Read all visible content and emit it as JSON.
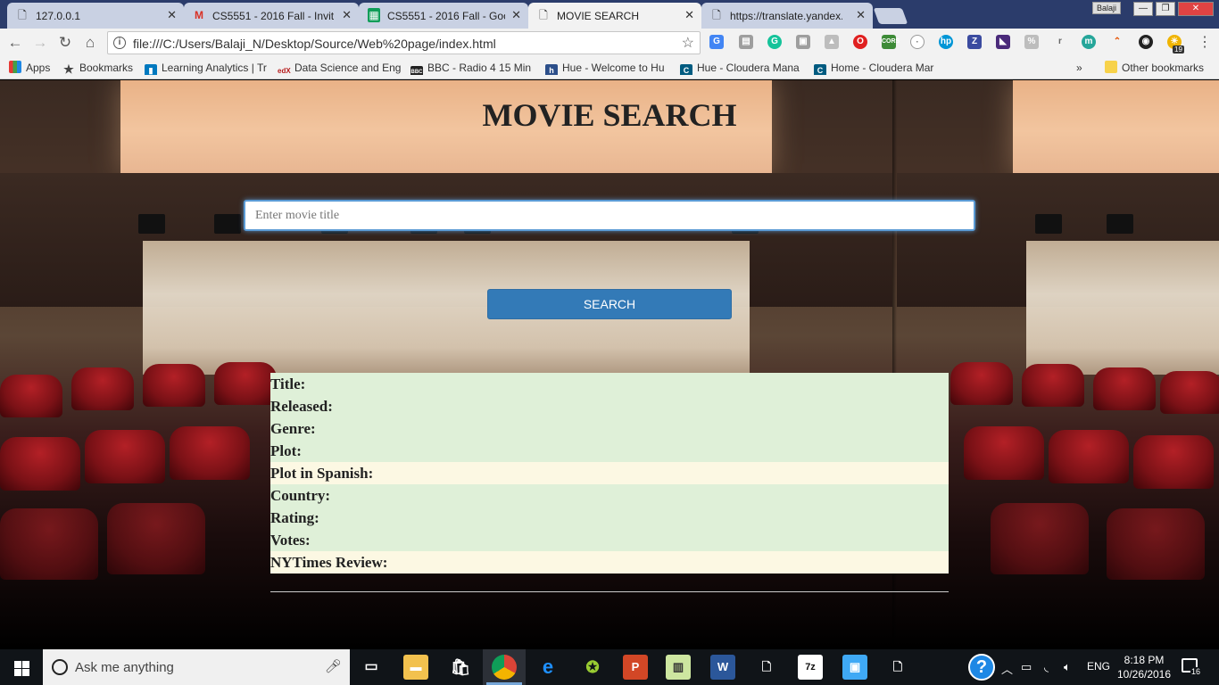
{
  "browser": {
    "tabs": [
      {
        "title": "127.0.0.1",
        "active": false
      },
      {
        "title": "CS5551 - 2016 Fall - Invit",
        "active": false
      },
      {
        "title": "CS5551 - 2016 Fall - Goo",
        "active": false
      },
      {
        "title": "MOVIE SEARCH",
        "active": true
      },
      {
        "title": "https://translate.yandex.",
        "active": false
      }
    ],
    "profile_name": "Balaji",
    "url": "file:///C:/Users/Balaji_N/Desktop/Source/Web%20page/index.html",
    "bookmarks": [
      "Apps",
      "Bookmarks",
      "Learning Analytics | Tr",
      "Data Science and Eng",
      "BBC - Radio 4 15 Min",
      "Hue - Welcome to Hu",
      "Hue - Cloudera Mana",
      "Home - Cloudera Mar"
    ],
    "bookmarks_overflow": "»",
    "other_bookmarks": "Other bookmarks",
    "extension_badge": "19"
  },
  "page": {
    "title": "MOVIE SEARCH",
    "search_placeholder": "Enter movie title",
    "search_button": "SEARCH",
    "fields": [
      {
        "label": "Title:",
        "color": "#dff0d8"
      },
      {
        "label": "Released:",
        "color": "#dff0d8"
      },
      {
        "label": "Genre:",
        "color": "#dff0d8"
      },
      {
        "label": "Plot:",
        "color": "#dff0d8"
      },
      {
        "label": "Plot in Spanish:",
        "color": "#fcf8e3"
      },
      {
        "label": "Country:",
        "color": "#dff0d8"
      },
      {
        "label": "Rating:",
        "color": "#dff0d8"
      },
      {
        "label": "Votes:",
        "color": "#dff0d8"
      },
      {
        "label": "NYTimes Review:",
        "color": "#fcf8e3"
      }
    ]
  },
  "taskbar": {
    "search_placeholder": "Ask me anything",
    "language": "ENG",
    "time": "8:18 PM",
    "date": "10/26/2016",
    "notification_count": "16"
  }
}
